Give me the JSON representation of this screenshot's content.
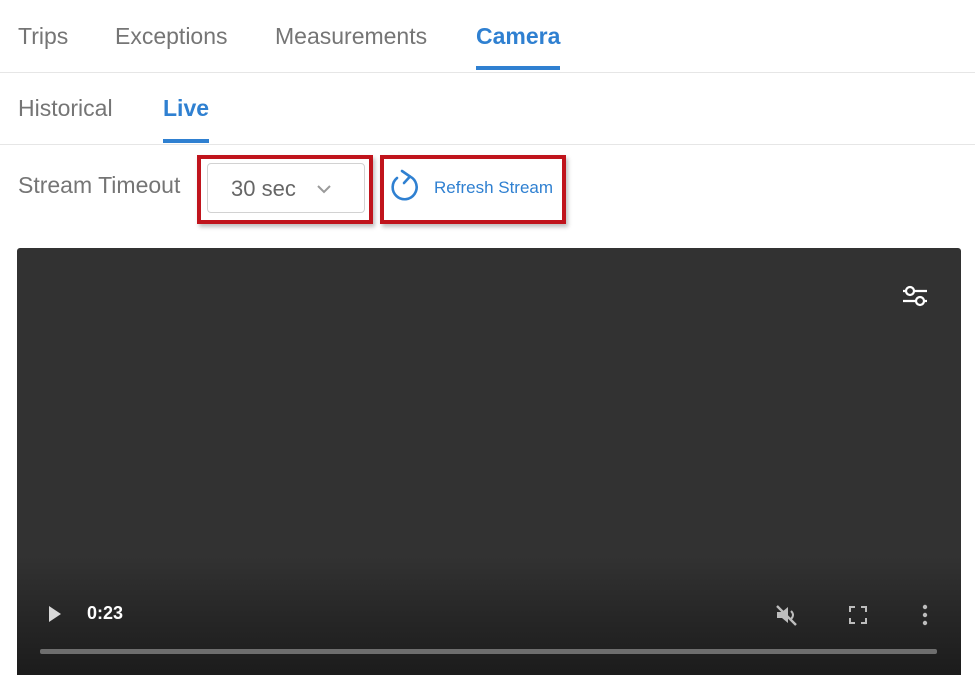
{
  "main_tabs": [
    {
      "label": "Trips",
      "active": false
    },
    {
      "label": "Exceptions",
      "active": false
    },
    {
      "label": "Measurements",
      "active": false
    },
    {
      "label": "Camera",
      "active": true
    }
  ],
  "sub_tabs": [
    {
      "label": "Historical",
      "active": false
    },
    {
      "label": "Live",
      "active": true
    }
  ],
  "stream": {
    "timeout_label": "Stream Timeout",
    "timeout_value": "30 sec",
    "refresh_label": "Refresh Stream"
  },
  "video": {
    "current_time": "0:23",
    "muted": true
  },
  "colors": {
    "accent": "#2f80d1",
    "highlight": "#c0141c",
    "video_bg": "#323232"
  },
  "icons": [
    "chevron-down-icon",
    "refresh-icon",
    "settings-sliders-icon",
    "play-icon",
    "mute-icon",
    "fullscreen-icon",
    "more-vert-icon"
  ]
}
